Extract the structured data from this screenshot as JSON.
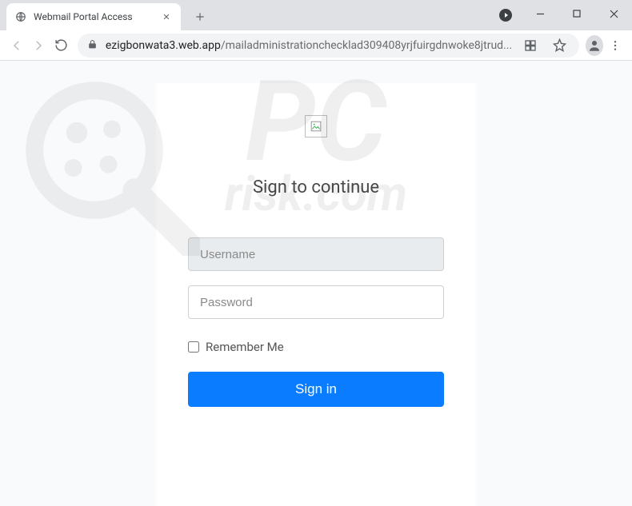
{
  "browser": {
    "tab_title": "Webmail Portal Access",
    "url_host": "ezigbonwata3.web.app",
    "url_path": "/mailadministrationchecklad309408yrjfuirgdnwoke8jtrud...",
    "new_tab_label": "+"
  },
  "login": {
    "heading": "Sign to continue",
    "username_placeholder": "Username",
    "password_placeholder": "Password",
    "remember_label": "Remember Me",
    "signin_label": "Sign in"
  },
  "watermark": {
    "line1": "PC",
    "line2": "risk.com"
  }
}
